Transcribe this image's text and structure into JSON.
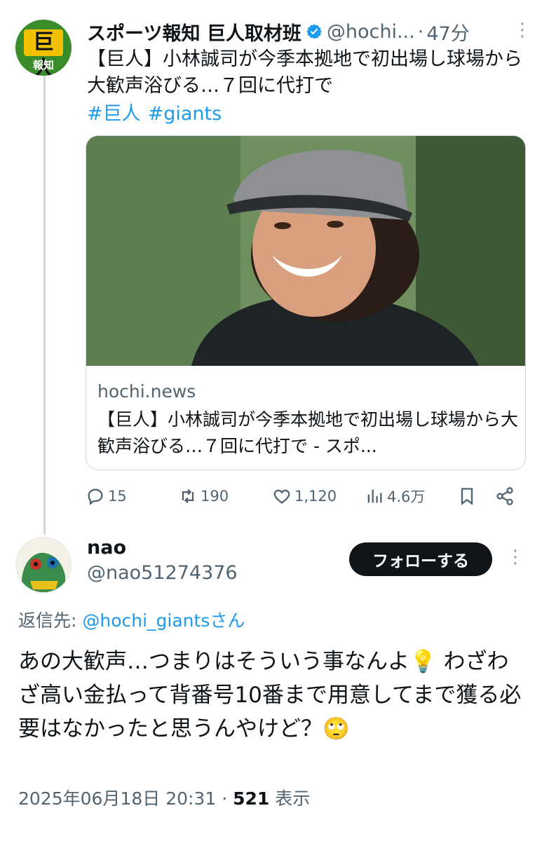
{
  "tweet": {
    "avatar_text_top": "巨人",
    "avatar_text_bottom": "報知",
    "name": "スポーツ報知 巨人取材班",
    "handle": "@hochi...",
    "separator": "·",
    "time": "47分",
    "more_icon": "more-vertical-icon",
    "text": "【巨人】小林誠司が今季本拠地で初出場し球場から大歓声浴びる…７回に代打で",
    "hashtags": [
      "#巨人",
      "#giants"
    ],
    "card": {
      "domain": "hochi.news",
      "title": "【巨人】小林誠司が今季本拠地で初出場し球場から大歓声浴びる…７回に代打で - スポ..."
    },
    "actions": {
      "replies": "15",
      "retweets": "190",
      "likes": "1,120",
      "views": "4.6万"
    }
  },
  "reply": {
    "name": "nao",
    "handle": "@nao51274376",
    "follow_label": "フォローする",
    "reply_to_label": "返信先: ",
    "reply_to_mention": "@hochi_giantsさん",
    "text": "あの大歓声…つまりはそういう事なんよ💡 わざわざ高い金払って背番号10番まで用意してまで獲る必要はなかったと思うんやけど？🙄",
    "timestamp": "2025年06月18日 20:31",
    "separator": " · ",
    "view_count": "521",
    "view_label": " 表示"
  },
  "colors": {
    "accent": "#1d9bf0",
    "text": "#0f1419",
    "muted": "#536471",
    "border": "#cfd9de"
  }
}
